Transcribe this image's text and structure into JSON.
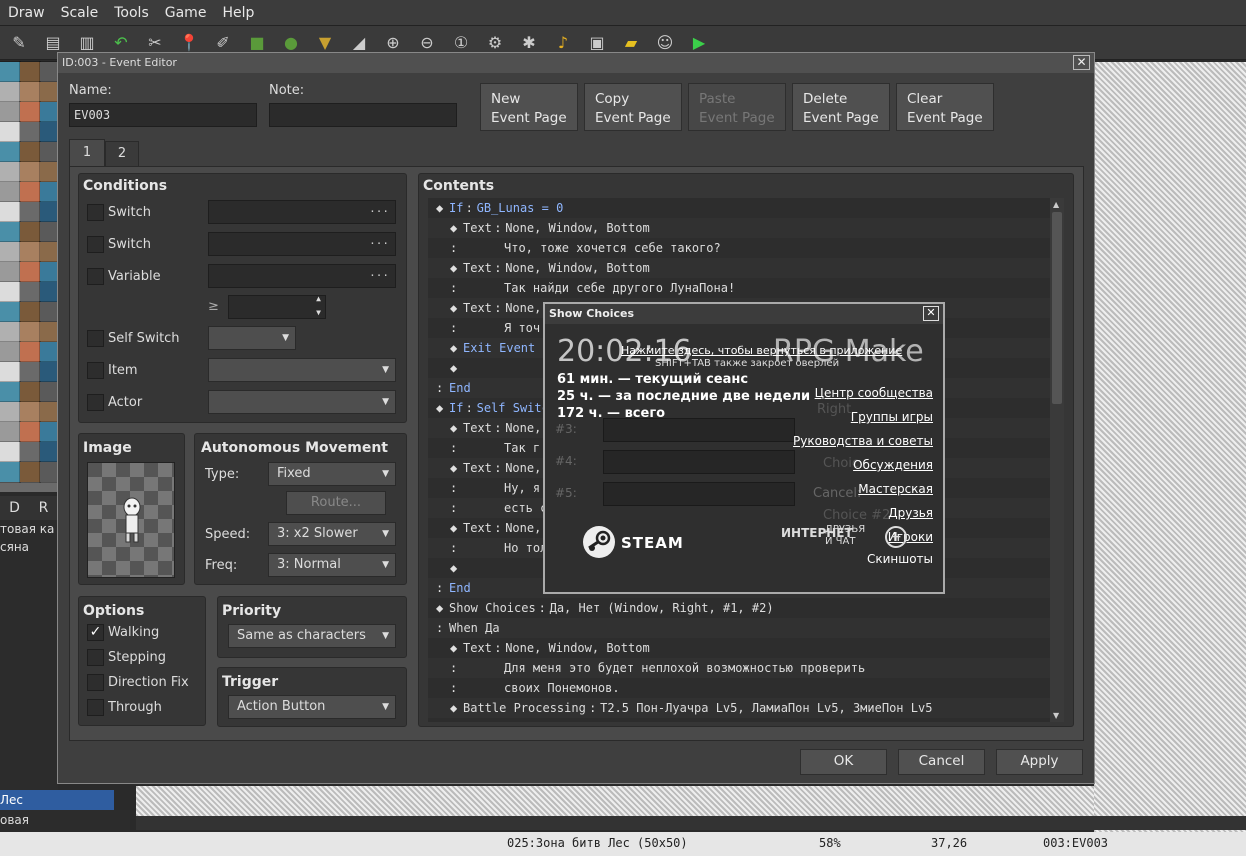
{
  "menubar": [
    "Draw",
    "Scale",
    "Tools",
    "Game",
    "Help"
  ],
  "toolbar_icons": [
    "pencil-icon",
    "copy-icon",
    "paste-icon",
    "undo-icon",
    "cut-icon",
    "pin-icon",
    "pen-icon",
    "rect-icon",
    "ellipse-icon",
    "fill-icon",
    "shadow-icon",
    "zoom-in-icon",
    "zoom-out-icon",
    "zoom-actual-icon",
    "gear-icon",
    "plugin-icon",
    "sound-icon",
    "resource-icon",
    "folder-icon",
    "character-icon",
    "play-icon"
  ],
  "palette_tabs": [
    "D",
    "R"
  ],
  "maplist": [
    "товая ка",
    "сяна"
  ],
  "map_selected": "Лес",
  "map_selected2": "овая",
  "status": {
    "map": "025:Зона битв Лес (50x50)",
    "zoom": "58%",
    "coords": "37,26",
    "event": "003:EV003"
  },
  "editor": {
    "title": "ID:003 - Event Editor",
    "name_label": "Name:",
    "name_value": "EV003",
    "note_label": "Note:",
    "note_value": "",
    "buttons": {
      "new": [
        "New",
        "Event Page"
      ],
      "copy": [
        "Copy",
        "Event Page"
      ],
      "paste": [
        "Paste",
        "Event Page"
      ],
      "delete": [
        "Delete",
        "Event Page"
      ],
      "clear": [
        "Clear",
        "Event Page"
      ]
    },
    "tabs": [
      "1",
      "2"
    ],
    "conditions": {
      "title": "Conditions",
      "switch1": "Switch",
      "switch2": "Switch",
      "variable": "Variable",
      "ge": "≥",
      "self_switch": "Self Switch",
      "item": "Item",
      "actor": "Actor"
    },
    "image_title": "Image",
    "autonomous": {
      "title": "Autonomous Movement",
      "type_label": "Type:",
      "type_value": "Fixed",
      "route": "Route...",
      "speed_label": "Speed:",
      "speed_value": "3: x2 Slower",
      "freq_label": "Freq:",
      "freq_value": "3: Normal"
    },
    "options": {
      "title": "Options",
      "walking": "Walking",
      "stepping": "Stepping",
      "direction_fix": "Direction Fix",
      "through": "Through"
    },
    "priority": {
      "title": "Priority",
      "value": "Same as characters"
    },
    "trigger": {
      "title": "Trigger",
      "value": "Action Button"
    },
    "contents_title": "Contents",
    "ok": "OK",
    "cancel": "Cancel",
    "apply": "Apply"
  },
  "lines": [
    {
      "i": 0,
      "d": "◆",
      "k": "If",
      "t": "GB_Lunas = 0",
      "c": "kw"
    },
    {
      "i": 1,
      "d": "◆",
      "k": "Text",
      "t": "None, Window, Bottom",
      "c": "wh"
    },
    {
      "i": 1,
      "d": ":",
      "k": "",
      "t": "Что, тоже хочется себе такого?",
      "c": "wh",
      "pad": true
    },
    {
      "i": 1,
      "d": "◆",
      "k": "Text",
      "t": "None, Window, Bottom",
      "c": "wh"
    },
    {
      "i": 1,
      "d": ":",
      "k": "",
      "t": "Так найди себе другого ЛунаПона!",
      "c": "wh",
      "pad": true
    },
    {
      "i": 1,
      "d": "◆",
      "k": "Text",
      "t": "None,",
      "c": "wh"
    },
    {
      "i": 1,
      "d": ":",
      "k": "",
      "t": "Я точ",
      "c": "wh",
      "pad": true
    },
    {
      "i": 1,
      "d": "◆",
      "k": "Exit Event",
      "t": "",
      "c": "kw",
      "nocolon": true
    },
    {
      "i": 1,
      "d": "◆",
      "k": "",
      "t": "",
      "c": "wh"
    },
    {
      "i": 0,
      "d": ":",
      "k": "End",
      "t": "",
      "c": "kw",
      "nocolon": true
    },
    {
      "i": 0,
      "d": "◆",
      "k": "If",
      "t": "Self Switc",
      "c": "kw"
    },
    {
      "i": 1,
      "d": "◆",
      "k": "Text",
      "t": "None,",
      "c": "wh"
    },
    {
      "i": 1,
      "d": ":",
      "k": "",
      "t": "Так г",
      "c": "wh",
      "pad": true
    },
    {
      "i": 1,
      "d": "◆",
      "k": "Text",
      "t": "None,",
      "c": "wh"
    },
    {
      "i": 1,
      "d": ":",
      "k": "",
      "t": "Ну, я",
      "c": "wh",
      "pad": true
    },
    {
      "i": 1,
      "d": ":",
      "k": "",
      "t": "есть с",
      "c": "wh",
      "pad": true
    },
    {
      "i": 1,
      "d": "◆",
      "k": "Text",
      "t": "None,",
      "c": "wh"
    },
    {
      "i": 1,
      "d": ":",
      "k": "",
      "t": "Но тол",
      "c": "wh",
      "pad": true
    },
    {
      "i": 1,
      "d": "◆",
      "k": "",
      "t": "",
      "c": "wh"
    },
    {
      "i": 0,
      "d": ":",
      "k": "End",
      "t": "",
      "c": "kw",
      "nocolon": true
    },
    {
      "i": 0,
      "d": "◆",
      "k": "Show Choices",
      "t": "Да, Нет (Window, Right, #1, #2)",
      "c": "wh"
    },
    {
      "i": 0,
      "d": ":",
      "k": "When Да",
      "t": "",
      "c": "wh",
      "nocolon": true
    },
    {
      "i": 1,
      "d": "◆",
      "k": "Text",
      "t": "None, Window, Bottom",
      "c": "wh"
    },
    {
      "i": 1,
      "d": ":",
      "k": "",
      "t": "Для меня это будет неплохой возможностью проверить",
      "c": "wh",
      "pad": true
    },
    {
      "i": 1,
      "d": ":",
      "k": "",
      "t": "своих Понемонов.",
      "c": "wh",
      "pad": true
    },
    {
      "i": 1,
      "d": "◆",
      "k": "Battle Processing",
      "t": "T2.5 Пон-Луачра Lv5, ЛамиаПон Lv5, ЗмиеПон Lv5",
      "c": "wh"
    }
  ],
  "choices": {
    "title": "Show Choices",
    "clock": "20:02:16",
    "app": "RPG Make",
    "hint": "Нажмите здесь, чтобы вернуться в приложение",
    "hint2": "SHIFT+TAB также закроет оверлей",
    "stats": [
      "61 мин. — текущий сеанс",
      "25 ч. — за последние две недели",
      "172 ч. — всего"
    ],
    "links": [
      "Центр сообщества",
      "Группы игры",
      "Руководства и советы",
      "Обсуждения",
      "Мастерская",
      "Друзья",
      "Игроки",
      "Скиншоты"
    ],
    "rows": [
      "#3:",
      "#4:",
      "#5:"
    ],
    "right_labels": [
      "Right",
      "Choic",
      "Cancel:",
      "Choice #2"
    ],
    "steam": "STEAM",
    "internet": "ИНТЕРНЕТ",
    "friends": "ДРУЗЬЯ И ЧАТ"
  }
}
